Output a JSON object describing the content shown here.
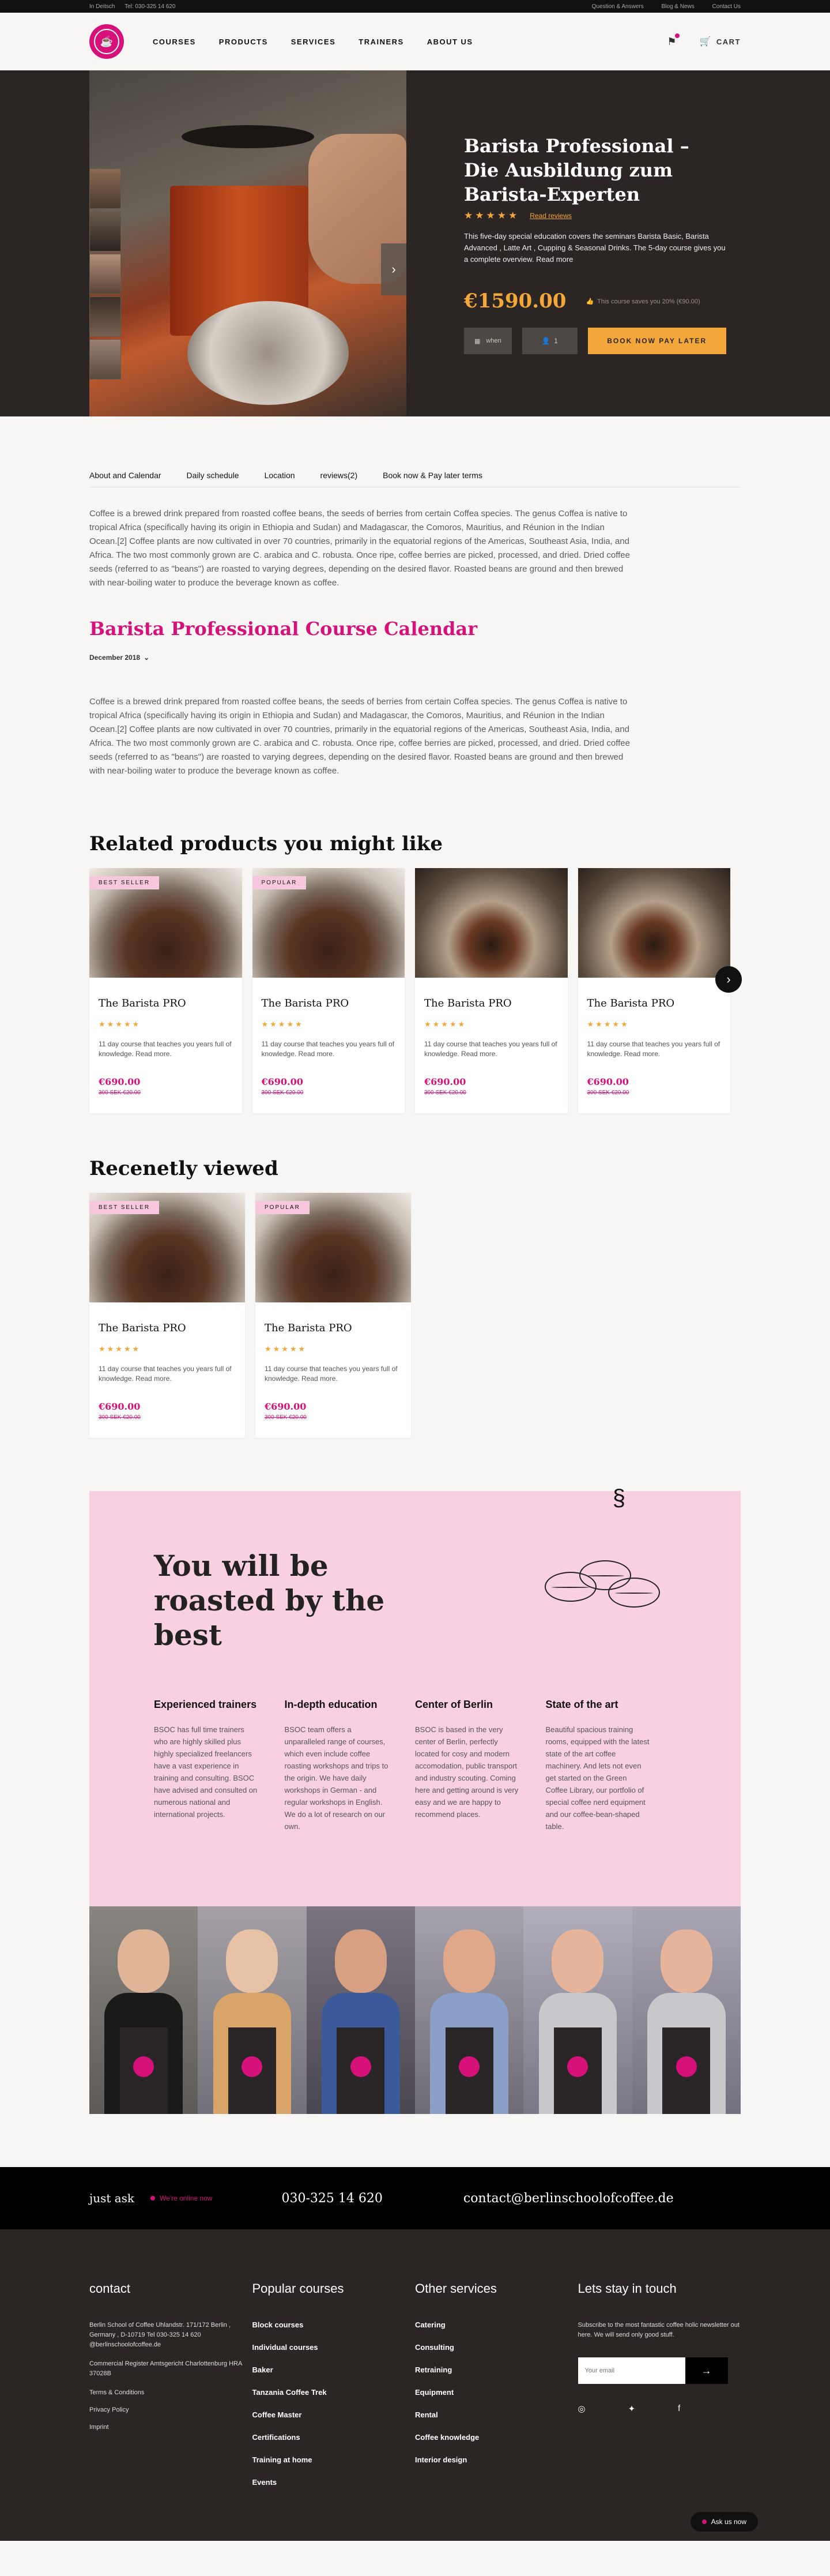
{
  "topbar": {
    "left": [
      "In Deitsch",
      "Tel: 030-325 14 620"
    ],
    "right": [
      "Question & Answers",
      "Blog & News",
      "Contact Us"
    ]
  },
  "nav": {
    "menu": [
      "COURSES",
      "PRODUCTS",
      "SERVICES",
      "TRAINERS",
      "ABOUT US"
    ],
    "cart": "CART"
  },
  "hero": {
    "title": "Barista Professional – Die Ausbildung zum Barista-Experten",
    "stars": "★★★★★",
    "read_reviews": "Read reviews",
    "description": "This five-day special education covers the seminars Barista Basic, Barista Advanced , Latte Art , Cupping & Seasonal Drinks. The 5-day course gives you a complete overview. Read more",
    "price": "€1590.00",
    "save_text": "This course saves you 20% (€90.00)",
    "select_label": "when",
    "qty": "1",
    "book_label": "BOOK NOW PAY LATER"
  },
  "tabs": [
    "About and Calendar",
    "Daily schedule",
    "Location",
    "reviews(2)",
    "Book now & Pay later terms"
  ],
  "about_text": "Coffee is a brewed drink prepared from roasted coffee beans, the seeds of berries from certain Coffea species. The genus Coffea is native to tropical Africa (specifically having its origin in Ethiopia and Sudan) and Madagascar, the Comoros, Mauritius, and Réunion in the Indian Ocean.[2] Coffee plants are now cultivated in over 70 countries, primarily in the equatorial regions of the Americas, Southeast Asia, India, and Africa. The two most commonly grown are C. arabica and C. robusta. Once ripe, coffee berries are picked, processed, and dried. Dried coffee seeds (referred to as \"beans\") are roasted to varying degrees, depending on the desired flavor. Roasted beans are ground and then brewed with near-boiling water to produce the beverage known as coffee.",
  "calendar": {
    "title": "Barista Professional Course Calendar",
    "month": "December 2018"
  },
  "related": {
    "title": "Related products you might like",
    "items": [
      {
        "badge": "BEST SELLER",
        "name": "The Barista PRO",
        "stars": "★★★★★",
        "desc": "11 day course that teaches you years full of knowledge. Read more.",
        "price": "€690.00",
        "old": "300 SEK €20.00"
      },
      {
        "badge": "POPULAR",
        "name": "The Barista PRO",
        "stars": "★★★★★",
        "desc": "11 day course that teaches you years full of knowledge. Read more.",
        "price": "€690.00",
        "old": "300 SEK €20.00"
      },
      {
        "badge": "",
        "name": "The Barista PRO",
        "stars": "★★★★★",
        "desc": "11 day course that teaches you years full of knowledge. Read more.",
        "price": "€690.00",
        "old": "300 SEK €20.00"
      },
      {
        "badge": "",
        "name": "The Barista PRO",
        "stars": "★★★★★",
        "desc": "11 day course that teaches you years full of knowledge. Read more.",
        "price": "€690.00",
        "old": "300 SEK €20.00"
      }
    ]
  },
  "recent": {
    "title": "Recenetly viewed",
    "items": [
      {
        "badge": "BEST SELLER",
        "name": "The Barista PRO",
        "stars": "★★★★★",
        "desc": "11 day course that teaches you years full of knowledge. Read more.",
        "price": "€690.00",
        "old": "300 SEK €20.00"
      },
      {
        "badge": "POPULAR",
        "name": "The Barista PRO",
        "stars": "★★★★★",
        "desc": "11 day course that teaches you years full of knowledge. Read more.",
        "price": "€690.00",
        "old": "300 SEK €20.00"
      }
    ]
  },
  "roast": {
    "title": "You will be roasted by the best",
    "features": [
      {
        "title": "Experienced trainers",
        "text": "BSOC has full time trainers who are highly skilled plus highly specialized freelancers have a vast experience in training and consulting. BSOC have advised and consulted on numerous national and international projects."
      },
      {
        "title": "In-depth education",
        "text": "BSOC team offers a unparalleled range of courses, which even include coffee roasting workshops and trips to the origin. We have daily workshops in German - and regular workshops in English. We do a lot of research on our own."
      },
      {
        "title": "Center of Berlin",
        "text": "BSOC is based in the very center of Berlin, perfectly located for cosy and modern accomodation, public transport and industry scouting. Coming here and getting around is very easy and we are happy to recommend places."
      },
      {
        "title": "State of the art",
        "text": "Beautiful spacious training rooms, equipped with the latest state of the art coffee machinery. And lets not even get started on the Green Coffee Library, our portfolio of special coffee nerd equipment and our coffee-bean-shaped table."
      }
    ]
  },
  "ask": {
    "just": "just ask",
    "online": "We're online now",
    "phone": "030-325 14 620",
    "email": "contact@berlinschoolofcoffee.de"
  },
  "footer": {
    "contact_title": "contact",
    "address": "Berlin School of Coffee Uhlandstr. 171/172 Berlin , Germany , D-10719 Tel 030-325 14 620 @berlinschoolofcoffee.de",
    "register": "Commercial Register Amtsgericht Charlottenburg HRA 37028B",
    "links": [
      "Terms & Conditions",
      "Privacy Policy",
      "Imprint"
    ],
    "popular_title": "Popular courses",
    "popular": [
      "Block courses",
      "Individual courses",
      "Baker",
      "Tanzania Coffee Trek",
      "Coffee Master",
      "Certifications",
      "Training at home",
      "Events"
    ],
    "other_title": "Other services",
    "other": [
      "Catering",
      "Consulting",
      "Retraining",
      "Equipment",
      "Rental",
      "Coffee knowledge",
      "Interior design"
    ],
    "touch_title": "Lets stay in touch",
    "newsletter": "Subscribe to the most fantastic coffee holic newsletter out here. We will send only good stuff.",
    "email_placeholder": "Your email",
    "chat": "Ask us now"
  }
}
